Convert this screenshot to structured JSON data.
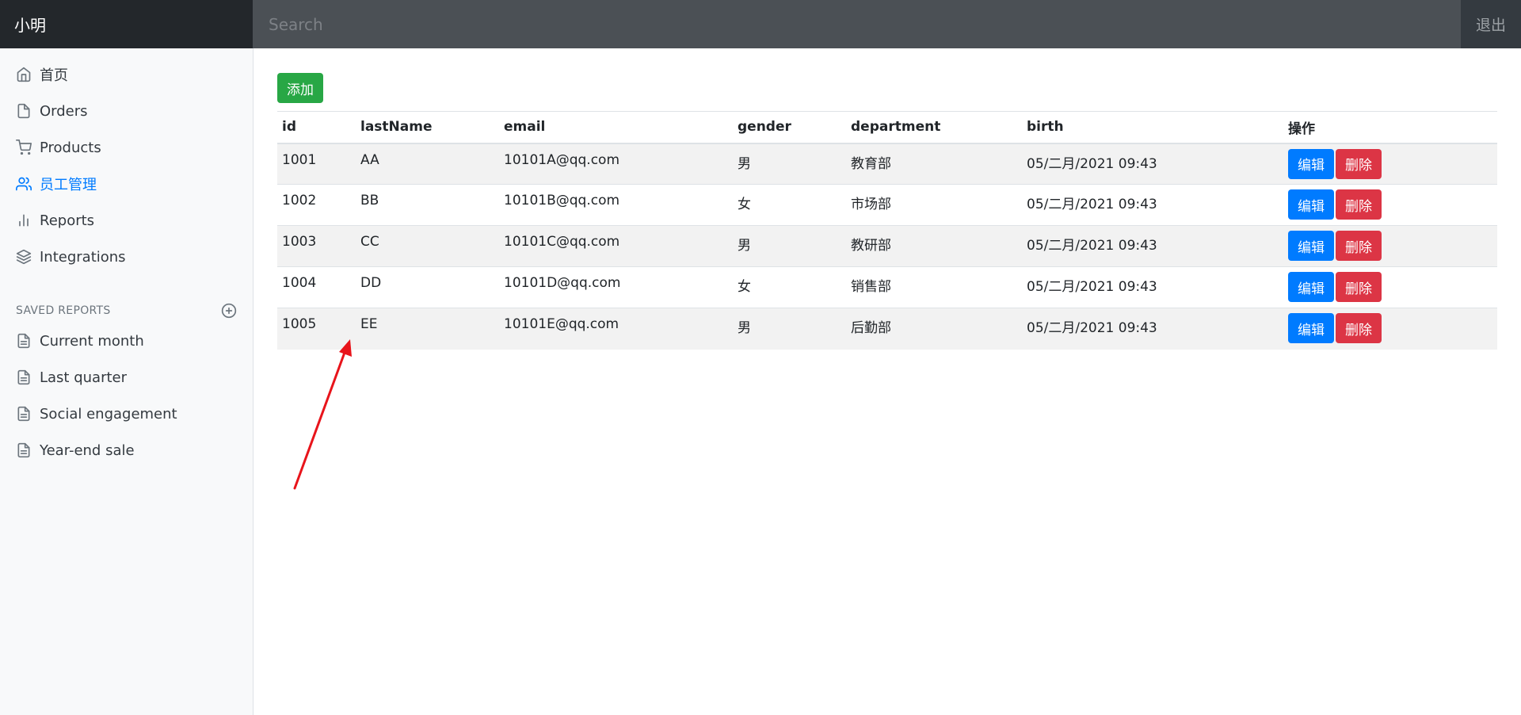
{
  "navbar": {
    "brand": "小明",
    "search_placeholder": "Search",
    "logout": "退出"
  },
  "sidebar": {
    "items": [
      {
        "label": "首页",
        "icon": "home-icon",
        "active": false
      },
      {
        "label": "Orders",
        "icon": "file-icon",
        "active": false
      },
      {
        "label": "Products",
        "icon": "shopping-cart-icon",
        "active": false
      },
      {
        "label": "员工管理",
        "icon": "users-icon",
        "active": true
      },
      {
        "label": "Reports",
        "icon": "bar-chart-icon",
        "active": false
      },
      {
        "label": "Integrations",
        "icon": "layers-icon",
        "active": false
      }
    ],
    "saved_heading": "SAVED REPORTS",
    "saved_items": [
      {
        "label": "Current month"
      },
      {
        "label": "Last quarter"
      },
      {
        "label": "Social engagement"
      },
      {
        "label": "Year-end sale"
      }
    ]
  },
  "main": {
    "add_label": "添加",
    "columns": [
      "id",
      "lastName",
      "email",
      "gender",
      "department",
      "birth",
      "操作"
    ],
    "rows": [
      {
        "id": "1001",
        "lastName": "AA",
        "email": "10101A@qq.com",
        "gender": "男",
        "department": "教育部",
        "birth": "05/二月/2021 09:43"
      },
      {
        "id": "1002",
        "lastName": "BB",
        "email": "10101B@qq.com",
        "gender": "女",
        "department": "市场部",
        "birth": "05/二月/2021 09:43"
      },
      {
        "id": "1003",
        "lastName": "CC",
        "email": "10101C@qq.com",
        "gender": "男",
        "department": "教研部",
        "birth": "05/二月/2021 09:43"
      },
      {
        "id": "1004",
        "lastName": "DD",
        "email": "10101D@qq.com",
        "gender": "女",
        "department": "销售部",
        "birth": "05/二月/2021 09:43"
      },
      {
        "id": "1005",
        "lastName": "EE",
        "email": "10101E@qq.com",
        "gender": "男",
        "department": "后勤部",
        "birth": "05/二月/2021 09:43"
      }
    ],
    "edit_label": "编辑",
    "delete_label": "删除"
  },
  "colors": {
    "add": "#28a745",
    "edit": "#007bff",
    "delete": "#dc3545",
    "active_nav": "#007bff",
    "annotation": "#e8141b"
  }
}
